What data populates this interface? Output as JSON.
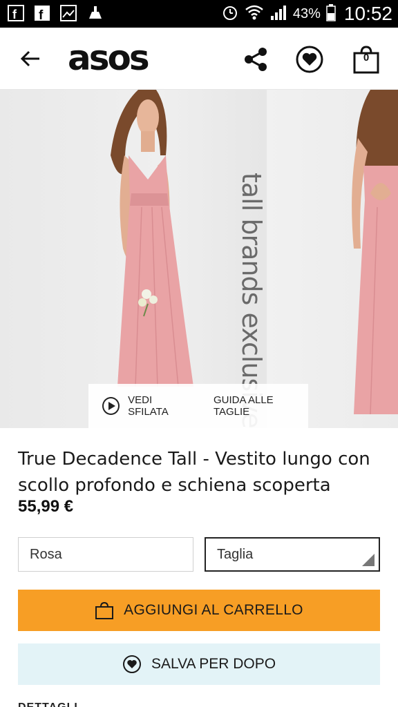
{
  "status_bar": {
    "battery_percent": "43%",
    "time": "10:52"
  },
  "header": {
    "logo": "asos",
    "bag_count": "0"
  },
  "gallery": {
    "overlay_text": "tall brands exclusive",
    "watch_video": "VEDI SFILATA",
    "size_guide": "GUIDA ALLE TAGLIE"
  },
  "product": {
    "title": "True Decadence Tall - Vestito lungo con scollo profondo e schiena scoperta",
    "price": "55,99 €",
    "colour": "Rosa",
    "size_placeholder": "Taglia"
  },
  "actions": {
    "add_to_bag": "AGGIUNGI AL CARRELLO",
    "save_for_later": "SALVA PER DOPO"
  },
  "sections": {
    "details": "DETTAGLI"
  },
  "colors": {
    "accent_orange": "#f79e25",
    "save_bg": "#e3f3f7",
    "dress_pink": "#e9a3a5"
  }
}
